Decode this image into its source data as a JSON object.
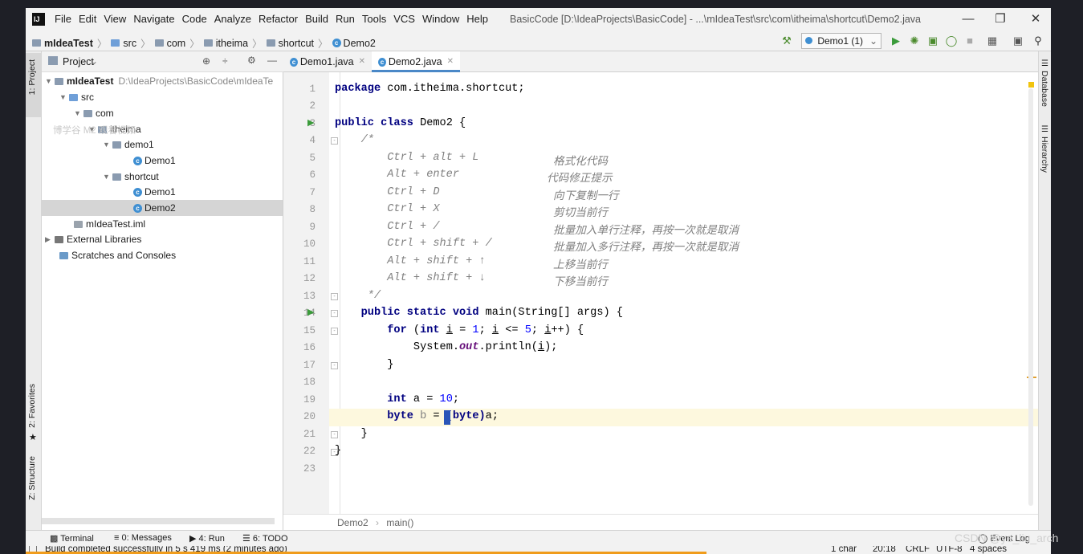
{
  "titlebar": {
    "menu": [
      "File",
      "Edit",
      "View",
      "Navigate",
      "Code",
      "Analyze",
      "Refactor",
      "Build",
      "Run",
      "Tools",
      "VCS",
      "Window",
      "Help"
    ],
    "title": "BasicCode [D:\\IdeaProjects\\BasicCode] - ...\\mIdeaTest\\src\\com\\itheima\\shortcut\\Demo2.java"
  },
  "breadcrumbs": [
    "mIdeaTest",
    "src",
    "com",
    "itheima",
    "shortcut",
    "Demo2"
  ],
  "run_config": "Demo1 (1)",
  "left_strip": {
    "project": "1: Project",
    "favorites": "2: Favorites",
    "structure": "Z: Structure"
  },
  "right_strip": {
    "database": "Database",
    "hierarchy": "Hierarchy"
  },
  "project_panel": {
    "title": "Project",
    "tree": [
      {
        "label": "mIdeaTest",
        "extra": "D:\\IdeaProjects\\BasicCode\\mIdeaTe"
      },
      {
        "label": "src"
      },
      {
        "label": "com"
      },
      {
        "label": "itheima"
      },
      {
        "label": "demo1"
      },
      {
        "label": "Demo1"
      },
      {
        "label": "shortcut"
      },
      {
        "label": "Demo1"
      },
      {
        "label": "Demo2"
      },
      {
        "label": "mIdeaTest.iml"
      },
      {
        "label": "External Libraries"
      },
      {
        "label": "Scratches and Consoles"
      }
    ],
    "watermark": "博学谷 M2 观看视频"
  },
  "editor": {
    "tabs": [
      "Demo1.java",
      "Demo2.java"
    ],
    "line_numbers": [
      "1",
      "2",
      "3",
      "4",
      "5",
      "6",
      "7",
      "8",
      "9",
      "10",
      "11",
      "12",
      "13",
      "14",
      "15",
      "16",
      "17",
      "18",
      "19",
      "20",
      "21",
      "22",
      "23"
    ],
    "code": {
      "l1_kw": "package",
      "l1_rest": " com.itheima.shortcut;",
      "l3_kw": "public class",
      "l3_rest": " Demo2 {",
      "l4": "    /*",
      "l5a": "        Ctrl + alt + L",
      "l5b": "格式化代码",
      "l6a": "        Alt + enter",
      "l6b": "代码修正提示",
      "l7a": "        Ctrl + D",
      "l7b": "向下复制一行",
      "l8a": "        Ctrl + X",
      "l8b": "剪切当前行",
      "l9a": "        Ctrl + /",
      "l9b": "批量加入单行注释，再按一次就是取消",
      "l10a": "        Ctrl + shift + /",
      "l10b": "批量加入多行注释，再按一次就是取消",
      "l11a": "        Alt + shift + ↑",
      "l11b": "上移当前行",
      "l12a": "        Alt + shift + ↓",
      "l12b": "下移当前行",
      "l13": "     */",
      "l14_kw": "public static void",
      "l14_rest": " main(String[] args) {",
      "l15_kw": "for",
      "l15_a": " (",
      "l15_kw2": "int",
      "l15_b": " ",
      "l15_i": "i",
      "l15_c": " = ",
      "l15_n1": "1",
      "l15_d": "; ",
      "l15_i2": "i",
      "l15_e": " <= ",
      "l15_n2": "5",
      "l15_f": "; ",
      "l15_i3": "i",
      "l15_g": "++) {",
      "l16_a": "System.",
      "l16_out": "out",
      "l16_b": ".println(",
      "l16_i": "i",
      "l16_c": ");",
      "l17": "}",
      "l19_kw": "int",
      "l19_a": " a = ",
      "l19_n": "10",
      "l19_b": ";",
      "l20_kw": "byte",
      "l20_var": " b",
      "l20_a": " = ",
      "l20_kw2": "(byte)",
      "l20_b": "a;",
      "l21": "}",
      "l22": "}"
    },
    "bottom_crumbs": [
      "Demo2",
      "main()"
    ]
  },
  "bottom_tabs": {
    "terminal": "Terminal",
    "messages": "0: Messages",
    "run": "4: Run",
    "todo": "6: TODO",
    "event_log": "Event Log"
  },
  "status": {
    "message": "Build completed successfully in 5 s 419 ms (2 minutes ago)",
    "chars": "1 char",
    "pos": "20:18",
    "line_sep": "CRLF",
    "encoding": "UTF-8",
    "indent": "4 spaces"
  },
  "overlay_watermark": "CSDN @ye_liu_arch",
  "colors": {
    "keyword": "#000080",
    "comment": "#808080",
    "number": "#0000ff",
    "static": "#660e7a",
    "progress": "#f09c1b",
    "caret": "#2a55b8"
  }
}
